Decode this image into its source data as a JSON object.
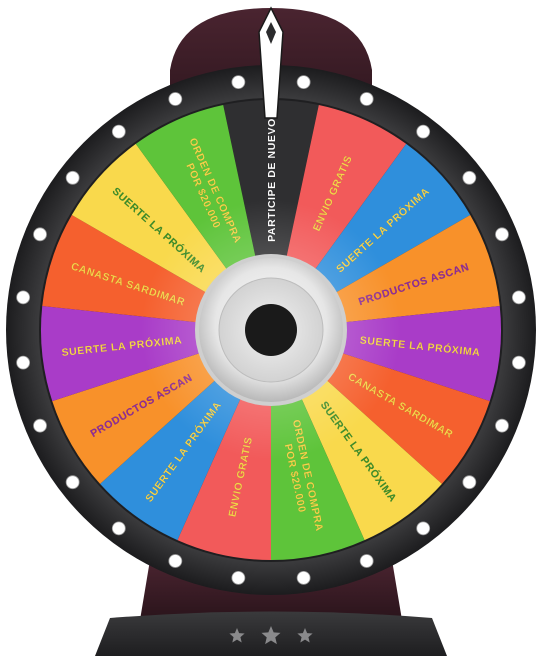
{
  "wheel": {
    "pointer_label": "PARTICIPE DE NUEVO",
    "segments": [
      {
        "label": "PARTICIPE DE NUEVO",
        "color": "#2f2f31",
        "text_color": "#ffffff"
      },
      {
        "label": "ENVIO GRATIS",
        "color": "#f25a5a",
        "text_color": "#f7d44a"
      },
      {
        "label": "SUERTE LA PRÓXIMA",
        "color": "#2f8fdc",
        "text_color": "#f7d44a"
      },
      {
        "label": "PRODUCTOS ASCAN",
        "color": "#f8912a",
        "text_color": "#8e2a9e"
      },
      {
        "label": "SUERTE LA PRÓXIMA",
        "color": "#a93cc8",
        "text_color": "#f7d44a"
      },
      {
        "label": "CANASTA SARDIMAR",
        "color": "#f5602e",
        "text_color": "#f7d44a"
      },
      {
        "label": "SUERTE LA PRÓXIMA",
        "color": "#f9d94c",
        "text_color": "#3a8f2a"
      },
      {
        "label": "ORDEN DE COMPRA POR $20.000",
        "color": "#5ec43a",
        "text_color": "#f7d44a"
      },
      {
        "label": "ENVIO GRATIS",
        "color": "#f25a5a",
        "text_color": "#f7d44a"
      },
      {
        "label": "SUERTE LA PRÓXIMA",
        "color": "#2f8fdc",
        "text_color": "#f7d44a"
      },
      {
        "label": "PRODUCTOS ASCAN",
        "color": "#f8912a",
        "text_color": "#8e2a9e"
      },
      {
        "label": "SUERTE LA PRÓXIMA",
        "color": "#a93cc8",
        "text_color": "#f7d44a"
      },
      {
        "label": "CANASTA SARDIMAR",
        "color": "#f5602e",
        "text_color": "#f7d44a"
      },
      {
        "label": "SUERTE LA PRÓXIMA",
        "color": "#f9d94c",
        "text_color": "#3a8f2a"
      },
      {
        "label": "ORDEN DE COMPRA POR $20.000",
        "color": "#5ec43a",
        "text_color": "#f7d44a"
      }
    ],
    "rim_color": "#2b2b2d",
    "stand_color": "#3a1f26",
    "peg_count": 24,
    "stars": [
      "star-icon",
      "star-icon",
      "star-icon"
    ]
  }
}
